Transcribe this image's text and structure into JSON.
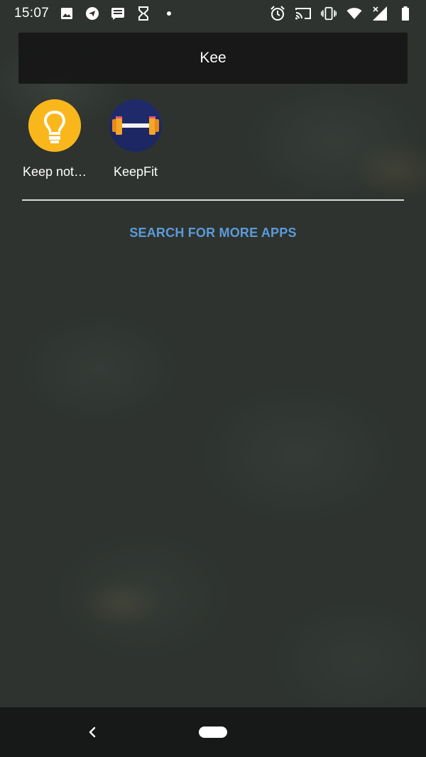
{
  "status_bar": {
    "time": "15:07",
    "left_icons": [
      "image-icon",
      "telegram-icon",
      "messages-icon",
      "hourglass-icon",
      "notification-dot-icon"
    ],
    "right_icons": [
      "alarm-icon",
      "cast-icon",
      "vibrate-icon",
      "wifi-icon",
      "cellular-signal-icon",
      "battery-icon"
    ]
  },
  "search": {
    "query": "Kee"
  },
  "apps": [
    {
      "label": "Keep not…",
      "icon": "keep-notes-icon",
      "color": "#F9B71C"
    },
    {
      "label": "KeepFit",
      "icon": "keepfit-icon",
      "color": "#1F2A6B"
    }
  ],
  "more_apps_label": "SEARCH FOR MORE APPS",
  "nav": {
    "back_icon": "back-icon",
    "home_icon": "home-pill-icon"
  },
  "colors": {
    "accent": "#5B9BD9",
    "keep_yellow": "#F9B71C",
    "keepfit_navy": "#1F2A6B",
    "keepfit_orange": "#F6A623"
  }
}
